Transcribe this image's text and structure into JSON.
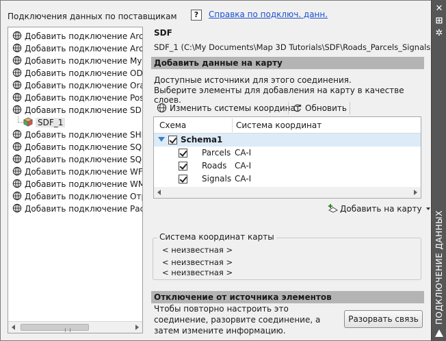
{
  "left": {
    "header": "Подключения данных по поставщикам",
    "items": [
      {
        "label": "Добавить подключение ArcGIS",
        "icon": "globe-icon"
      },
      {
        "label": "Добавить подключение ArcSD",
        "icon": "globe-icon"
      },
      {
        "label": "Добавить подключение MySQ",
        "icon": "globe-icon"
      },
      {
        "label": "Добавить подключение ODBC",
        "icon": "globe-icon"
      },
      {
        "label": "Добавить подключение Oracle",
        "icon": "globe-icon"
      },
      {
        "label": "Добавить подключение Postgr",
        "icon": "globe-icon"
      },
      {
        "label": "Добавить подключение SDF",
        "icon": "globe-icon"
      },
      {
        "label": "SDF_1",
        "icon": "cube-icon"
      },
      {
        "label": "Добавить подключение SHP",
        "icon": "globe-icon"
      },
      {
        "label": "Добавить подключение SQL Se",
        "icon": "globe-icon"
      },
      {
        "label": "Добавить подключение SQLite",
        "icon": "globe-icon"
      },
      {
        "label": "Добавить подключение WFS",
        "icon": "globe-icon"
      },
      {
        "label": "Добавить подключение WMS",
        "icon": "globe-icon"
      },
      {
        "label": "Добавить подключение Отрас",
        "icon": "globe-icon"
      },
      {
        "label": "Добавить подключение Растр",
        "icon": "globe-icon"
      }
    ]
  },
  "help": {
    "icon_text": "?",
    "link": "Справка по подключ. данн."
  },
  "main": {
    "title": "SDF",
    "path": "SDF_1 (C:\\My Documents\\Map 3D Tutorials\\SDF\\Roads_Parcels_Signals.sdf)",
    "add_section": "Добавить данные на карту",
    "desc1": "Доступные источники для этого соединения.",
    "desc2": "Выберите элементы для добавления на карту в качестве слоев.",
    "toolbar": {
      "change_cs": "Изменить системы координат",
      "refresh": "Обновить"
    },
    "grid": {
      "col_schema": "Схема",
      "col_cs": "Система координат",
      "schema": "Schema1",
      "rows": [
        {
          "name": "Parcels",
          "cs": "CA-I"
        },
        {
          "name": "Roads",
          "cs": "CA-I"
        },
        {
          "name": "Signals",
          "cs": "CA-I"
        }
      ]
    },
    "add_to_map": "Добавить на карту",
    "map_cs": {
      "legend": "Система координат карты",
      "lines": [
        "< неизвестная >",
        "< неизвестная >",
        "< неизвестная >"
      ]
    },
    "disconnect_section": "Отключение от источника элементов",
    "disconnect_text": "Чтобы повторно настроить это соединение, разорвите соединение, а затем измените информацию.",
    "disconnect_button": "Разорвать связь"
  },
  "strip": {
    "title": "ПОДКЛЮЧЕНИЕ ДАННЫХ",
    "icons": [
      "close-icon",
      "pin-icon",
      "settings-icon"
    ]
  }
}
